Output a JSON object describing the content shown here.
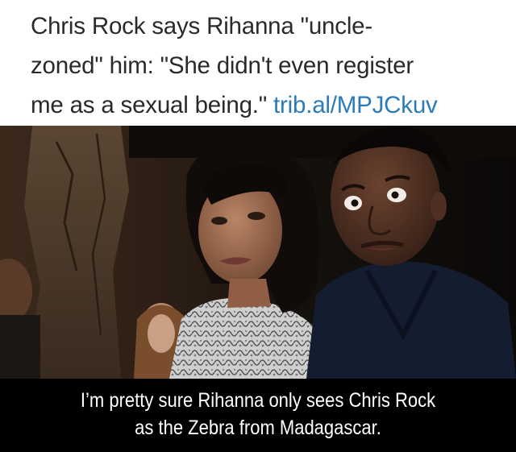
{
  "tweet": {
    "line1": "Chris Rock says Rihanna \"uncle-",
    "line2": "zoned\" him: \"She didn't even register",
    "line3_text": "me as a sexual being.\" ",
    "line3_link": "trib.al/MPJCkuv"
  },
  "photo": {
    "subject_left": "woman-with-dark-bob-hair",
    "subject_right": "man-in-navy-jacket"
  },
  "caption": {
    "line1": "I’m pretty sure Rihanna only sees Chris Rock",
    "line2": "as the Zebra from Madagascar."
  },
  "colors": {
    "header_bg": "#ffffff",
    "header_text": "#2a2a2a",
    "link": "#2b7bb9",
    "caption_bg": "#000000",
    "caption_text": "#ffffff"
  }
}
